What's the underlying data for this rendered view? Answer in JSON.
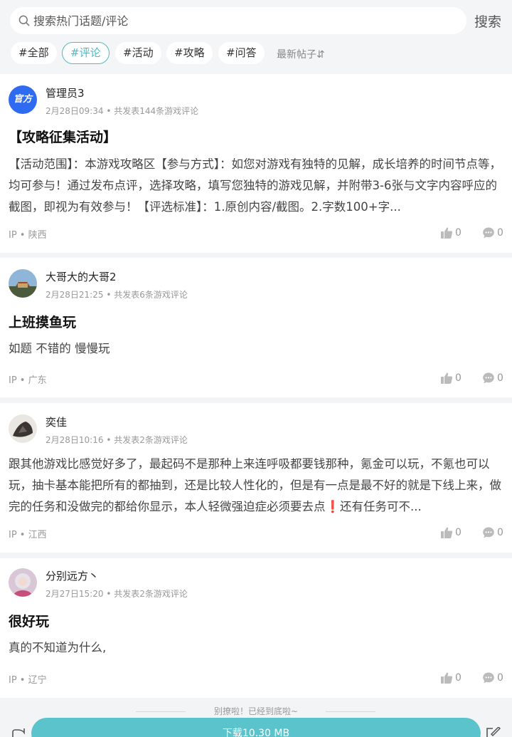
{
  "search": {
    "placeholder": "搜索热门话题/评论",
    "button_label": "搜索"
  },
  "tabs": [
    "#全部",
    "#评论",
    "#活动",
    "#攻略",
    "#问答"
  ],
  "active_tab": "#评论",
  "sort_label": "最新帖子⇵",
  "posts": [
    {
      "author": "管理员3",
      "avatar_text": "官方",
      "date": "2月28日09:34",
      "stats": "共发表144条游戏评论",
      "title": "【攻略征集活动】",
      "body": "【活动范围】：本游戏攻略区【参与方式】：如您对游戏有独特的见解，成长培养的时间节点等，均可参与！通过发布点评，选择攻略，填写您独特的游戏见解，并附带3-6张与文字内容呼应的截图，即视为有效参与！【评选标准】：1.原创内容/截图。2.字数100+字...",
      "ip": "IP • 陕西",
      "likes": "0",
      "comments": "0"
    },
    {
      "author": "大哥大的大哥2",
      "date": "2月28日21:25",
      "stats": "共发表6条游戏评论",
      "title": "上班摸鱼玩",
      "body": "如题 不错的 慢慢玩",
      "ip": "IP • 广东",
      "likes": "0",
      "comments": "0"
    },
    {
      "author": "奕佳",
      "date": "2月28日10:16",
      "stats": "共发表2条游戏评论",
      "title": "",
      "body": "跟其他游戏比感觉好多了，最起码不是那种上来连呼吸都要钱那种，氪金可以玩，不氪也可以玩，抽卡基本能把所有的都抽到，还是比较人性化的，但是有一点是最不好的就是下线上来，做完的任务和没做完的都给你显示，本人轻微强迫症必须要去点❗还有任务可不...",
      "ip": "IP • 江西",
      "likes": "0",
      "comments": "0"
    },
    {
      "author": "分别远方丶",
      "date": "2月27日15:20",
      "stats": "共发表2条游戏评论",
      "title": "很好玩",
      "body": "真的不知道为什么,",
      "ip": "IP • 辽宁",
      "likes": "0",
      "comments": "0"
    }
  ],
  "footer_note": "别撩啦！已经到底啦~",
  "download_label": "下载10.30 MB",
  "colors": {
    "accent": "#4fb9c4",
    "download": "#5bc3cb",
    "official_badge": "#2f6bf0"
  },
  "icons": {
    "search": "search-icon",
    "like": "thumbs-up-icon",
    "comment": "comment-bubble-icon",
    "share": "share-icon",
    "edit": "edit-icon"
  }
}
